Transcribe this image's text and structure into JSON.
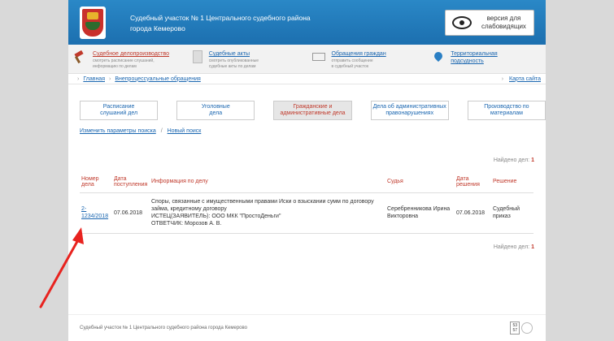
{
  "header": {
    "title_line1": "Судебный участок № 1 Центрального судебного района",
    "title_line2": "города Кемерово",
    "vision_line1": "версия для",
    "vision_line2": "слабовидящих"
  },
  "services": [
    {
      "title": "Судебное делопроизводство",
      "desc1": "смотреть расписание слушаний,",
      "desc2": "информацию по делам",
      "icon": "hammer-icon"
    },
    {
      "title": "Судебные акты",
      "desc1": "смотреть опубликованные",
      "desc2": "судебные акты по делам",
      "icon": "document-icon"
    },
    {
      "title": "Обращения граждан",
      "desc1": "отправить сообщение",
      "desc2": "в судебный участок",
      "icon": "mail-icon"
    },
    {
      "title": "Территориальная подсудность",
      "desc1": "",
      "desc2": "",
      "icon": "map-pin-icon"
    }
  ],
  "breadcrumb": {
    "home": "Главная",
    "current": "Внепроцессуальные обращения",
    "sitemap": "Карта сайта"
  },
  "categories": [
    {
      "line1": "Расписание",
      "line2": "слушаний дел"
    },
    {
      "line1": "Уголовные",
      "line2": "дела"
    },
    {
      "line1": "Гражданские и",
      "line2": "административные дела"
    },
    {
      "line1": "Дела об административных",
      "line2": "правонарушениях"
    },
    {
      "line1": "Производство по",
      "line2": "материалам"
    }
  ],
  "search": {
    "change": "Изменить параметры поиска",
    "new": "Новый поиск"
  },
  "found": {
    "label": "Найдено дел:",
    "count": "1"
  },
  "table": {
    "headers": {
      "number": [
        "Номер",
        "дела"
      ],
      "date": [
        "Дата",
        "поступления"
      ],
      "info": "Информация по делу",
      "judge": "Судья",
      "decision_date": [
        "Дата",
        "решения"
      ],
      "decision": "Решение"
    },
    "rows": [
      {
        "number1": "2-",
        "number2": "1234/2018",
        "date": "07.06.2018",
        "info1": "Споры, связанные с имущественными правами Иски о взыскании сумм по договору",
        "info2": "займа, кредитному договору",
        "info3": "ИСТЕЦ(ЗАЯВИТЕЛЬ): ООО МКК \"ПростоДеньги\"",
        "info4": "ОТВЕТЧИК: Морозов А. В.",
        "judge1": "Серебренникова Ирина",
        "judge2": "Викторовна",
        "decision_date": "07.06.2018",
        "decision1": "Судебный",
        "decision2": "приказ"
      }
    ]
  },
  "footer": {
    "text": "Судебный участок № 1 Центрального судебного района города Кемерово",
    "counter1": "53",
    "counter2": "57"
  },
  "colors": {
    "header": "#2a88c7",
    "link": "#1a66b0",
    "accent": "#c0392b",
    "arrow": "#e8231f"
  }
}
